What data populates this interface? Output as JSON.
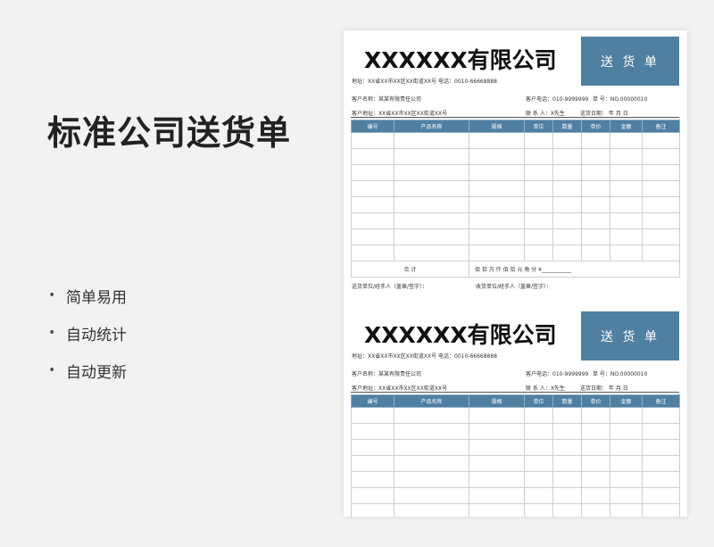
{
  "page": {
    "title": "标准公司送货单",
    "features": [
      "简单易用",
      "自动统计",
      "自动更新"
    ],
    "bullet": "•"
  },
  "form": {
    "company_name": "XXXXXX有限公司",
    "doc_badge": "送 货 单",
    "address_line": "地址：XX省XX市XX区XX街道XX号    电话：0010-66668888",
    "customer_name": "客户名称：某某有限责任公司",
    "customer_phone": "客户电话：010-9999999",
    "doc_no": "单    号：NO.00000010",
    "customer_address": "客户地址：XX省XX市XX区XX街道XX号",
    "contact": "联 系 人：X先生",
    "delivery_date": "送货日期：    年    月    日",
    "columns": [
      "编号",
      "产品名称",
      "规格",
      "单位",
      "数量",
      "单价",
      "金额",
      "备注"
    ],
    "total_label": "合    计",
    "total_text": "佰  拾  万  仟  佰  拾  元  角  分  ¥___________",
    "sender_sign": "送货单位/经手人（盖章/签字）：",
    "receiver_sign": "收货单位/经手人（盖章/签字）："
  },
  "colors": {
    "accent": "#4f7fa1",
    "background": "#f2f2f2"
  }
}
